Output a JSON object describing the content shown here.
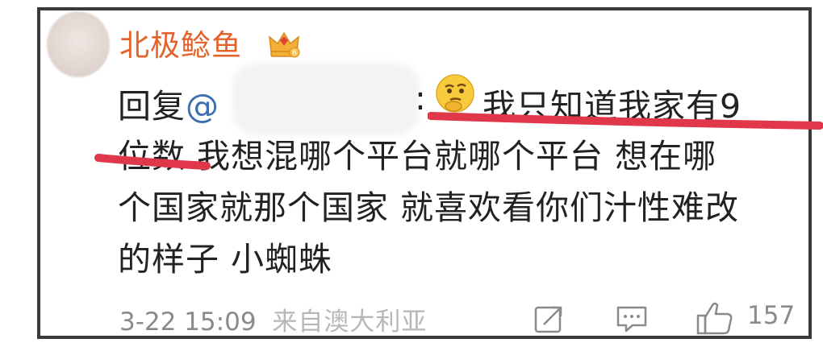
{
  "comment": {
    "username": "北极鲶鱼",
    "reply_prefix": "回复",
    "mention_at": "@",
    "mention_colon": ":",
    "lines": [
      "我只知道我家有9",
      "位数 我想混哪个平台就哪个平台 想在哪",
      "个国家就那个国家 就喜欢看你们汁性难改",
      "的样子 小蜘蛛"
    ],
    "timestamp": "3-22 15:09",
    "location": "来自澳大利亚",
    "like_count": "157"
  },
  "icons": {
    "badge": "crown-badge-icon",
    "emoji": "thinking-face-emoji",
    "share": "share-icon",
    "comment": "comment-icon",
    "like": "thumbs-up-icon"
  },
  "colors": {
    "username": "#e4622a",
    "mention": "#3b6fae",
    "highlight_underline": "#e0384a",
    "meta_text": "#8a8a8a"
  }
}
